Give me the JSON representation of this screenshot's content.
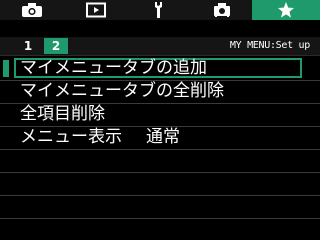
{
  "tabs": [
    {
      "id": "shoot",
      "icon": "camera-icon"
    },
    {
      "id": "play",
      "icon": "playback-icon"
    },
    {
      "id": "setup",
      "icon": "wrench-icon"
    },
    {
      "id": "custom",
      "icon": "custom-function-icon"
    },
    {
      "id": "mymenu",
      "icon": "star-icon",
      "active": true
    }
  ],
  "pages": {
    "page1": "1",
    "page2": "2"
  },
  "menu_title": "MY MENU:Set up",
  "items": [
    {
      "label": "マイメニュータブの追加"
    },
    {
      "label": "マイメニュータブの全削除"
    },
    {
      "label": "全項目削除"
    },
    {
      "label": "メニュー表示",
      "value": "通常"
    }
  ],
  "colors": {
    "accent": "#1e9a6c",
    "background": "#000000",
    "text": "#ffffff"
  }
}
